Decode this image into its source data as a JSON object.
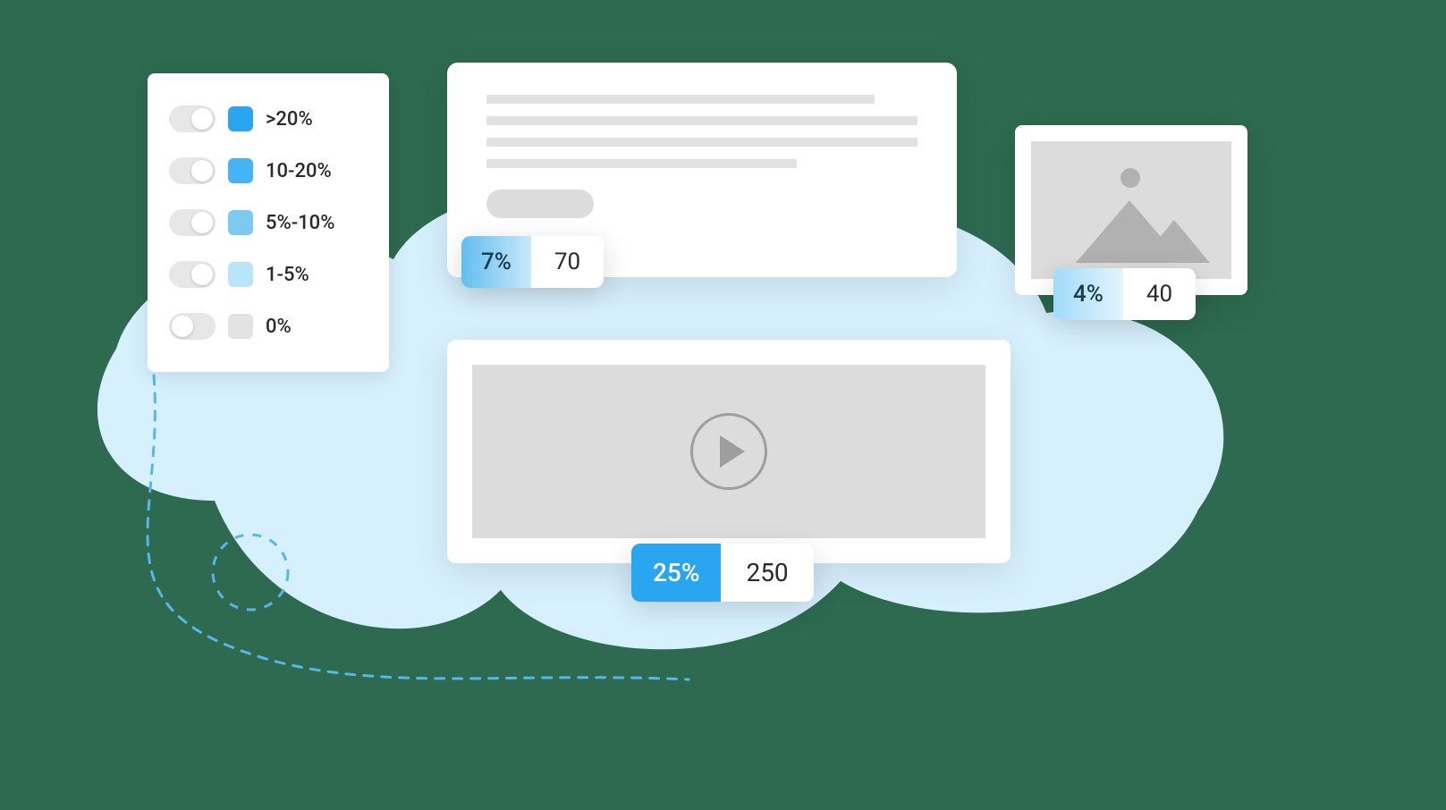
{
  "legend": {
    "items": [
      {
        "label": ">20%",
        "color": "#2aa5ef",
        "active": true
      },
      {
        "label": "10-20%",
        "color": "#45b4f5",
        "active": true
      },
      {
        "label": "5%-10%",
        "color": "#7cc9f2",
        "active": true
      },
      {
        "label": "1-5%",
        "color": "#b9e4fa",
        "active": true
      },
      {
        "label": "0%",
        "color": "#e3e3e3",
        "active": false
      }
    ]
  },
  "metrics": {
    "text": {
      "percent": "7%",
      "count": "70",
      "percent_bg": "linear-gradient(90deg,#62bef0,#c8e8fb)"
    },
    "video": {
      "percent": "25%",
      "count": "250",
      "percent_bg": "#2aa5ef"
    },
    "image": {
      "percent": "4%",
      "count": "40",
      "percent_bg": "linear-gradient(90deg,#a0dbf8,#e4f4fe)"
    }
  },
  "colors": {
    "cloud": "#d7f0fe",
    "dash": "#55b8e8"
  }
}
